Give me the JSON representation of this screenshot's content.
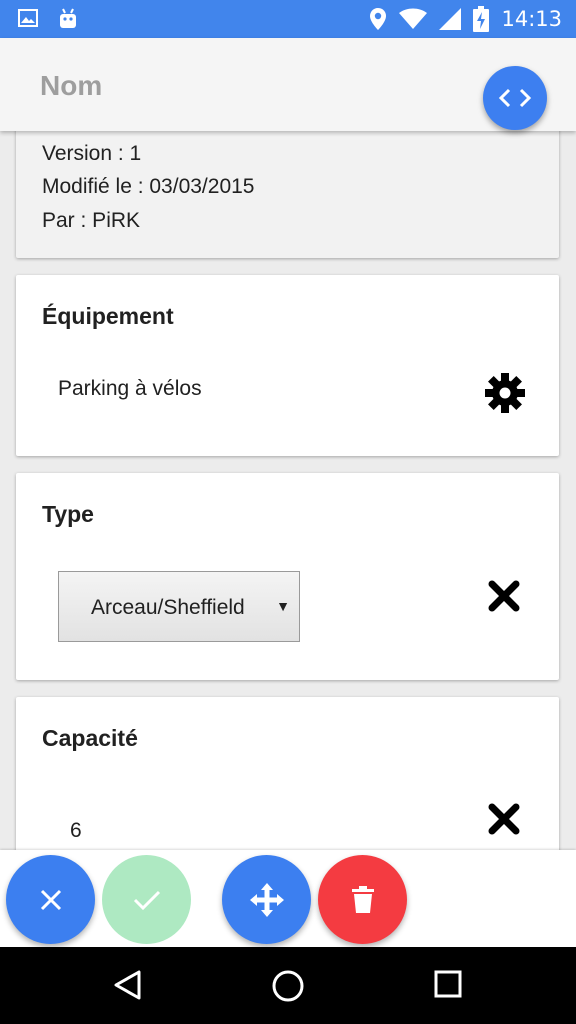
{
  "status_bar": {
    "time": "14:13",
    "icons": [
      "image-icon",
      "android-icon",
      "location-icon",
      "wifi-icon",
      "signal-icon",
      "battery-charging-icon"
    ],
    "color": "#4185ec"
  },
  "app_bar": {
    "title": "Nom",
    "action_icon": "code-icon"
  },
  "info": {
    "version": "Version : 1",
    "modified": "Modifié le : 03/03/2015",
    "author": "Par : PiRK"
  },
  "equipment": {
    "title": "Équipement",
    "value": "Parking à vélos",
    "icon": "gear-icon"
  },
  "type": {
    "title": "Type",
    "selected": "Arceau/Sheffield",
    "remove_icon": "close-icon"
  },
  "capacity": {
    "title": "Capacité",
    "value": "6",
    "remove_icon": "close-icon"
  },
  "actions": {
    "cancel_icon": "close-icon",
    "confirm_icon": "check-icon",
    "move_icon": "move-icon",
    "delete_icon": "trash-icon",
    "colors": {
      "blue": "#3c7ff0",
      "green": "#aee9c2",
      "red": "#f43b41"
    }
  },
  "nav_bar": {
    "icons": [
      "back-icon",
      "home-icon",
      "recents-icon"
    ]
  }
}
